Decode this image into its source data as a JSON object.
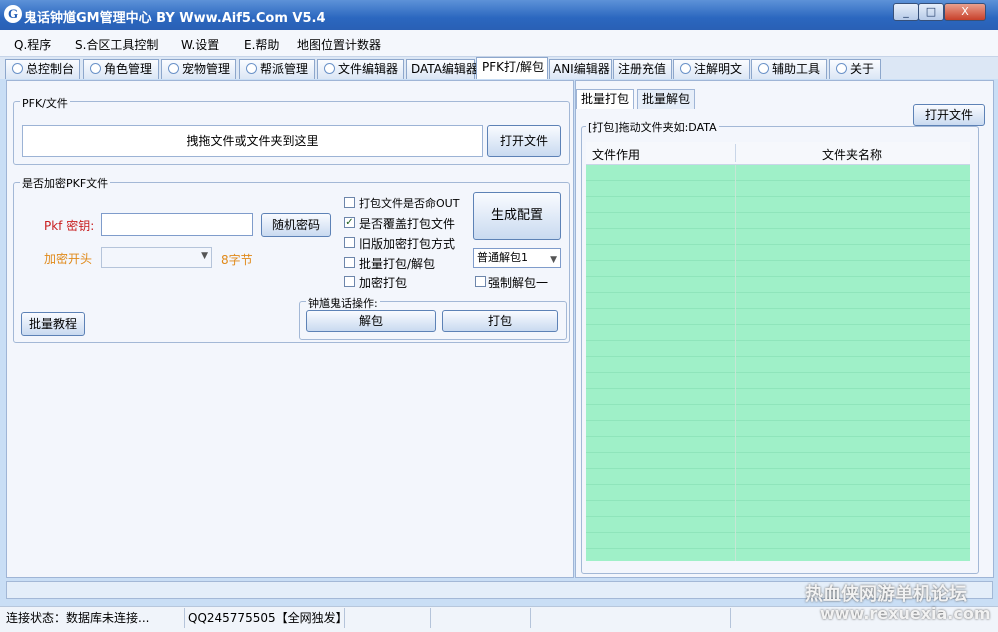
{
  "window": {
    "title": "鬼话钟馗GM管理中心 BY Www.Aif5.Com  V5.4",
    "icon_letter": "G",
    "controls": [
      "_",
      "□",
      "X"
    ]
  },
  "menu": [
    "Q.程序",
    "S.合区工具控制",
    "W.设置",
    "E.帮助",
    "地图位置计数器"
  ],
  "tabs": [
    {
      "label": "总控制台",
      "dot": true
    },
    {
      "label": "角色管理",
      "dot": true
    },
    {
      "label": "宠物管理",
      "dot": true
    },
    {
      "label": "帮派管理",
      "dot": true
    },
    {
      "label": "文件编辑器",
      "dot": true
    },
    {
      "label": "DATA编辑器",
      "dot": false
    },
    {
      "label": "PFK打/解包",
      "dot": false
    },
    {
      "label": "ANI编辑器",
      "dot": false
    },
    {
      "label": "注册充值",
      "dot": false
    },
    {
      "label": "注解明文",
      "dot": true
    },
    {
      "label": "辅助工具",
      "dot": true
    },
    {
      "label": "关于",
      "dot": true
    }
  ],
  "left": {
    "pfk_group": {
      "title": "PFK/文件",
      "drop_text": "拽拖文件或文件夹到这里",
      "open_button": "打开文件"
    },
    "encrypt_group": {
      "title": "是否加密PKF文件",
      "key_label": "Pkf 密钥:",
      "key_value": "",
      "random_button": "随机密码",
      "header_label": "加密开头",
      "header_value": "",
      "bytes_hint": "8字节",
      "checkboxes": [
        {
          "label": "打包文件是否命OUT",
          "checked": false
        },
        {
          "label": "是否覆盖打包文件",
          "checked": true
        },
        {
          "label": "旧版加密打包方式",
          "checked": false
        },
        {
          "label": "批量打包/解包",
          "checked": false
        },
        {
          "label": "加密打包",
          "checked": false
        }
      ],
      "generate_button": "生成配置",
      "unpack_mode": "普通解包1",
      "force_unpack": {
        "label": "强制解包一",
        "checked": false
      },
      "ops_title": "钟馗鬼话操作:",
      "unpack_button": "解包",
      "pack_button": "打包",
      "tutorial_button": "批量教程"
    }
  },
  "right": {
    "tabs": [
      "批量打包",
      "批量解包"
    ],
    "open_button": "打开文件",
    "group_title": "[打包]拖动文件夹如:DATA",
    "columns": [
      "文件作用",
      "文件夹名称"
    ]
  },
  "status": {
    "connection": "连接状态：数据库未连接...",
    "qq": "QQ245775505【全网独发】",
    "watermark_cn": "热血侠网游单机论坛",
    "watermark_url": "www.rexuexia.com"
  }
}
